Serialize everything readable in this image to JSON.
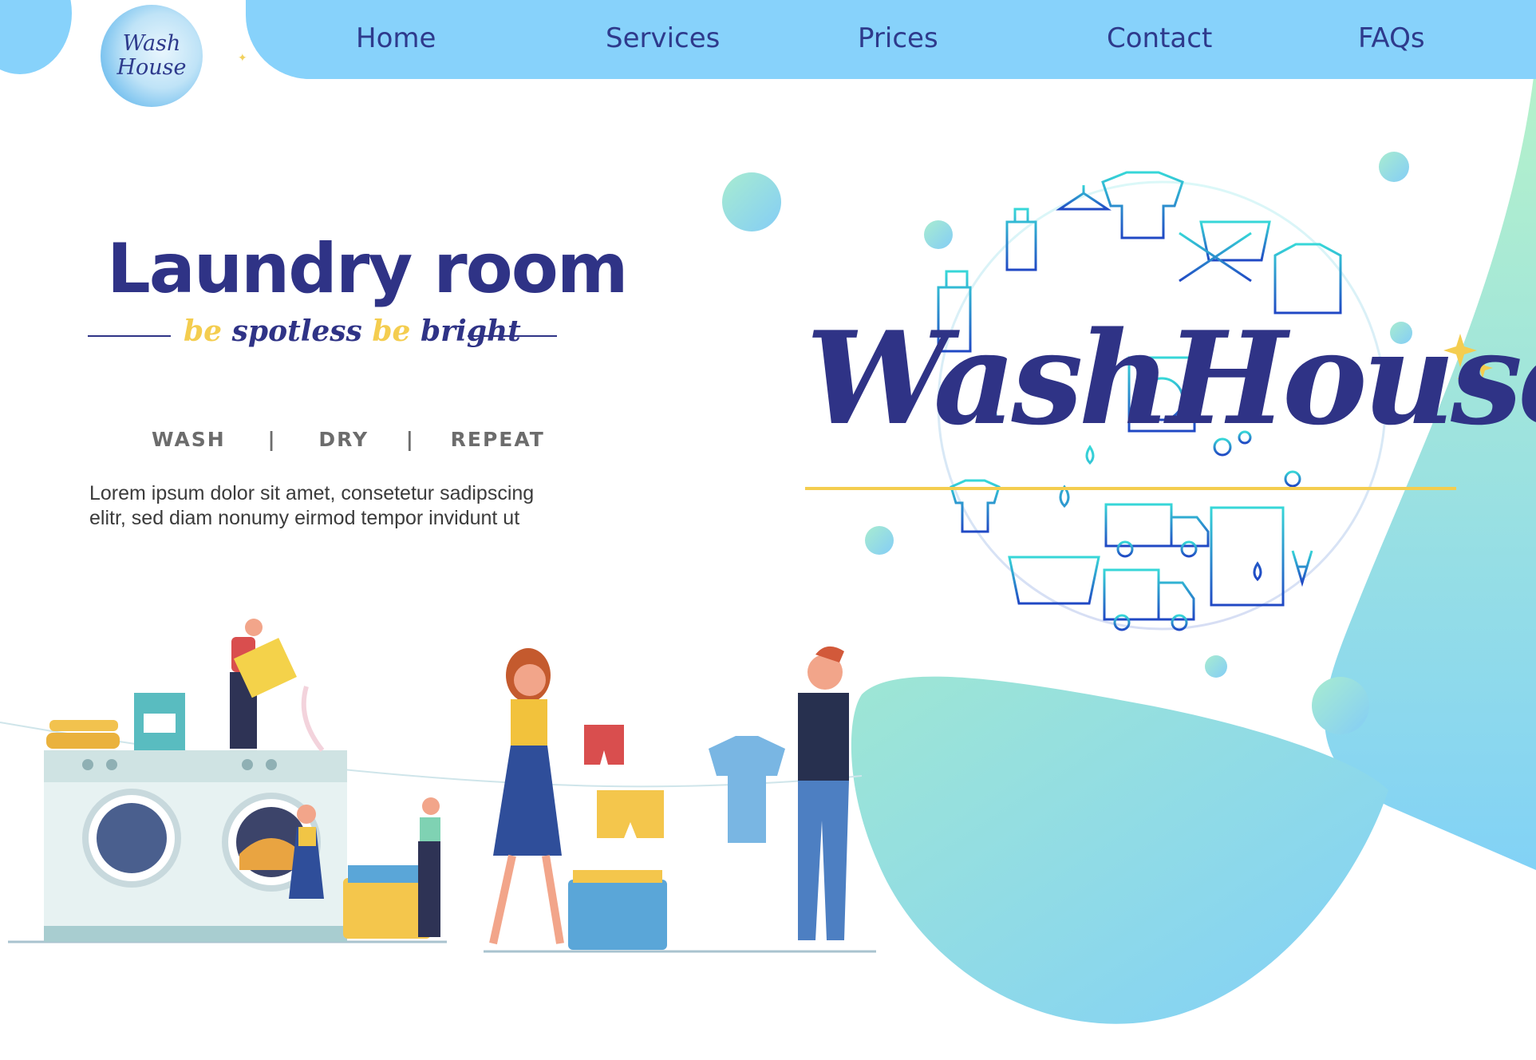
{
  "logo": {
    "line1": "Wash",
    "line2": "House"
  },
  "nav": {
    "items": [
      {
        "label": "Home"
      },
      {
        "label": "Services"
      },
      {
        "label": "Prices"
      },
      {
        "label": "Contact"
      },
      {
        "label": "FAQs"
      }
    ]
  },
  "hero": {
    "title": "Laundry room",
    "tagline": {
      "be1": "be",
      "word1": "spotless",
      "be2": "be",
      "word2": "bright"
    },
    "steps": [
      "WASH",
      "|",
      "DRY",
      "|",
      "REPEAT"
    ],
    "body": "Lorem ipsum dolor sit amet, consetetur sadipscing elitr, sed diam nonumy eirmod tempor invidunt ut"
  },
  "brand": {
    "name": "WashHouse"
  },
  "colors": {
    "nav_bg": "#87d2fb",
    "brand_text": "#2f3386",
    "accent_yellow": "#f4cd4f",
    "mint": "#9ee6d4",
    "sky": "#87d2fb"
  }
}
